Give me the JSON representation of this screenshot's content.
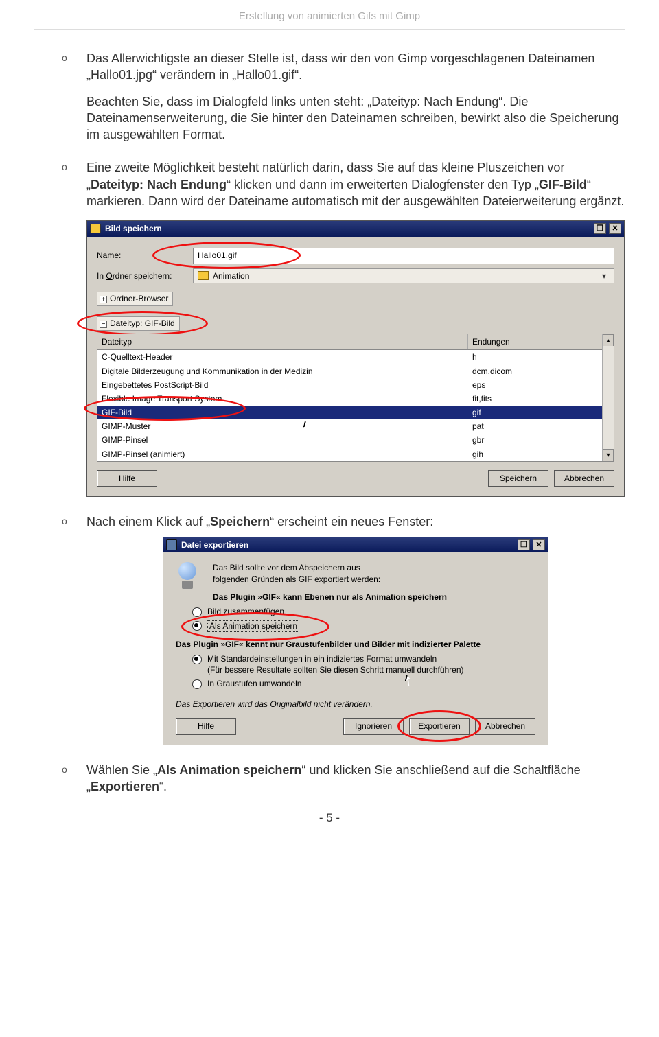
{
  "header_title": "Erstellung von animierten Gifs mit Gimp",
  "bullets": {
    "p1": "Das Allerwichtigste an dieser Stelle ist, dass wir den von Gimp vorgeschlagenen Dateinamen „Hallo01.jpg“ verändern in „Hallo01.gif“.",
    "p2": "Beachten Sie, dass im Dialogfeld links unten steht: „Dateityp: Nach Endung“. Die Dateinamenserweiterung, die Sie hinter den Dateinamen schreiben, bewirkt also die Speicherung im ausgewählten Format.",
    "p3a": "Eine zweite Möglichkeit besteht natürlich darin, dass Sie auf das kleine Pluszeichen vor „",
    "p3b": "Dateityp: Nach Endung",
    "p3c": "“ klicken und dann im erweiterten Dialogfenster den Typ „",
    "p3d": "GIF-Bild",
    "p3e": "“ markieren. Dann wird der Dateiname automatisch mit der ausgewählten Dateierweiterung ergänzt.",
    "p4a": "Nach einem Klick auf „",
    "p4b": "Speichern",
    "p4c": "“ erscheint ein neues Fenster:",
    "p5a": "Wählen Sie „",
    "p5b": "Als Animation speichern",
    "p5c": "“ und klicken Sie anschließend auf die Schaltfläche „",
    "p5d": "Exportieren",
    "p5e": "“."
  },
  "save_dlg": {
    "title": "Bild speichern",
    "name_label_u": "N",
    "name_label_rest": "ame:",
    "name_value": "Hallo01.gif",
    "folder_label_pre": "In ",
    "folder_label_u": "O",
    "folder_label_rest": "rdner speichern:",
    "folder_value": "Animation",
    "browser_label": "Ordner-Browser",
    "filetype_label_u": "D",
    "filetype_label": "ateityp: GIF-Bild",
    "col1": "Dateityp",
    "col2": "Endungen",
    "rows": [
      {
        "type": "C-Quelltext-Header",
        "ext": "h"
      },
      {
        "type": "Digitale Bilderzeugung und Kommunikation in der Medizin",
        "ext": "dcm,dicom"
      },
      {
        "type": "Eingebettetes PostScript-Bild",
        "ext": "eps"
      },
      {
        "type": "Flexible Image Transport System",
        "ext": "fit,fits"
      },
      {
        "type": "GIF-Bild",
        "ext": "gif"
      },
      {
        "type": "GIMP-Muster",
        "ext": "pat"
      },
      {
        "type": "GIMP-Pinsel",
        "ext": "gbr"
      },
      {
        "type": "GIMP-Pinsel (animiert)",
        "ext": "gih"
      }
    ],
    "btn_help_u": "H",
    "btn_help": "ilfe",
    "btn_save_u": "S",
    "btn_save": "peichern",
    "btn_cancel_u": "A",
    "btn_cancel": "bbrechen"
  },
  "export_dlg": {
    "title": "Datei exportieren",
    "intro1": "Das Bild sollte vor dem Abspeichern aus",
    "intro2": "folgenden Gründen als GIF exportiert werden:",
    "sec1": "Das Plugin »GIF« kann Ebenen nur als Animation speichern",
    "opt1": "Bild zusammenfügen",
    "opt2": "Als Animation speichern",
    "sec2": "Das Plugin »GIF« kennt nur Graustufenbilder und Bilder mit indizierter Palette",
    "opt3a": "Mit Standardeinstellungen in ein indiziertes Format umwandeln",
    "opt3b": "(Für bessere Resultate sollten Sie diesen Schritt manuell durchführen)",
    "opt4": "In Graustufen umwandeln",
    "note": "Das Exportieren wird das Originalbild nicht verändern.",
    "btn_help_u": "H",
    "btn_help": "ilfe",
    "btn_ignore_u": "I",
    "btn_ignore_a": "gnorier",
    "btn_ignore_b": "en",
    "btn_export_u": "E",
    "btn_export": "xportieren",
    "btn_cancel_pre": "A",
    "btn_cancel_u": "b",
    "btn_cancel": "brechen"
  },
  "page_num": "- 5 -"
}
